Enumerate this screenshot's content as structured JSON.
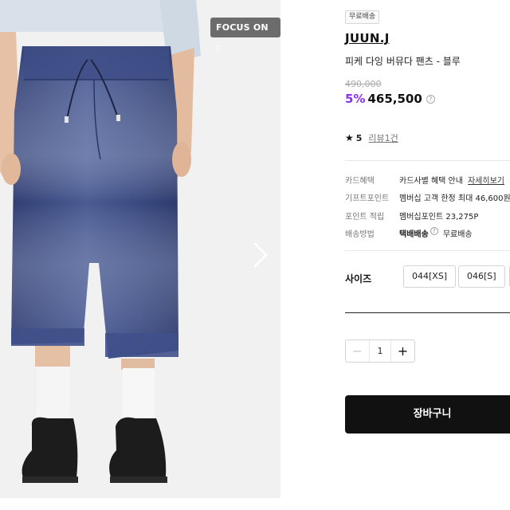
{
  "image": {
    "badge": "FOCUS ON :",
    "alt_colors": {
      "denim": "#3c4c82",
      "shirt": "#d8e1ea",
      "background": "#f1f1f1"
    }
  },
  "product": {
    "shipping_badge": "무료배송",
    "brand": "JUUN.J",
    "name": "피케 다잉 버뮤다 팬츠 - 블루",
    "original_price": "490,000",
    "discount": "5%",
    "sale_price": "465,500",
    "help_symbol": "?"
  },
  "rating": {
    "star": "★",
    "value": "5",
    "review_link": "리뷰1건"
  },
  "benefits": [
    {
      "label": "카드혜택",
      "value": "카드사별 혜택 안내",
      "link": "자세히보기"
    },
    {
      "label": "기프트포인트",
      "value": "멤버십 고객 한정 최대 46,600원"
    },
    {
      "label": "포인트 적립",
      "value": "멤버십포인트 23,275P"
    },
    {
      "label": "배송방법",
      "value": "택배배송",
      "extra": "무료배송"
    }
  ],
  "size": {
    "label": "사이즈",
    "options": [
      "044[XS]",
      "046[S]"
    ]
  },
  "quantity": {
    "minus": "−",
    "value": "1",
    "plus": "+"
  },
  "cart_button": "장바구니",
  "colors": {
    "discount": "#8b2ff5",
    "cart_bg": "#111111"
  }
}
